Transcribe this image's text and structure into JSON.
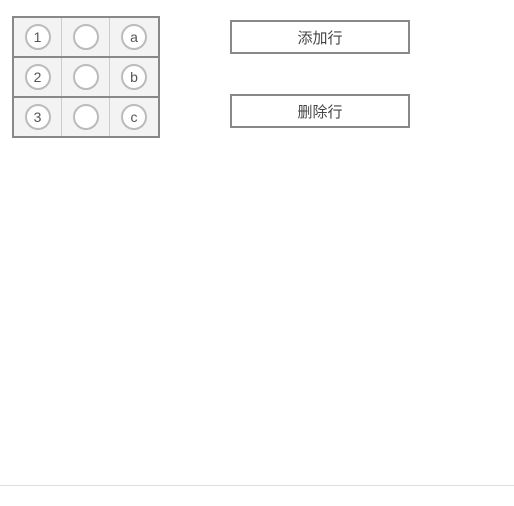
{
  "table": {
    "rows": [
      {
        "c0": "1",
        "c1": "",
        "c2": "a"
      },
      {
        "c0": "2",
        "c1": "",
        "c2": "b"
      },
      {
        "c0": "3",
        "c1": "",
        "c2": "c"
      }
    ]
  },
  "buttons": {
    "add_row": "添加行",
    "delete_row": "删除行"
  }
}
